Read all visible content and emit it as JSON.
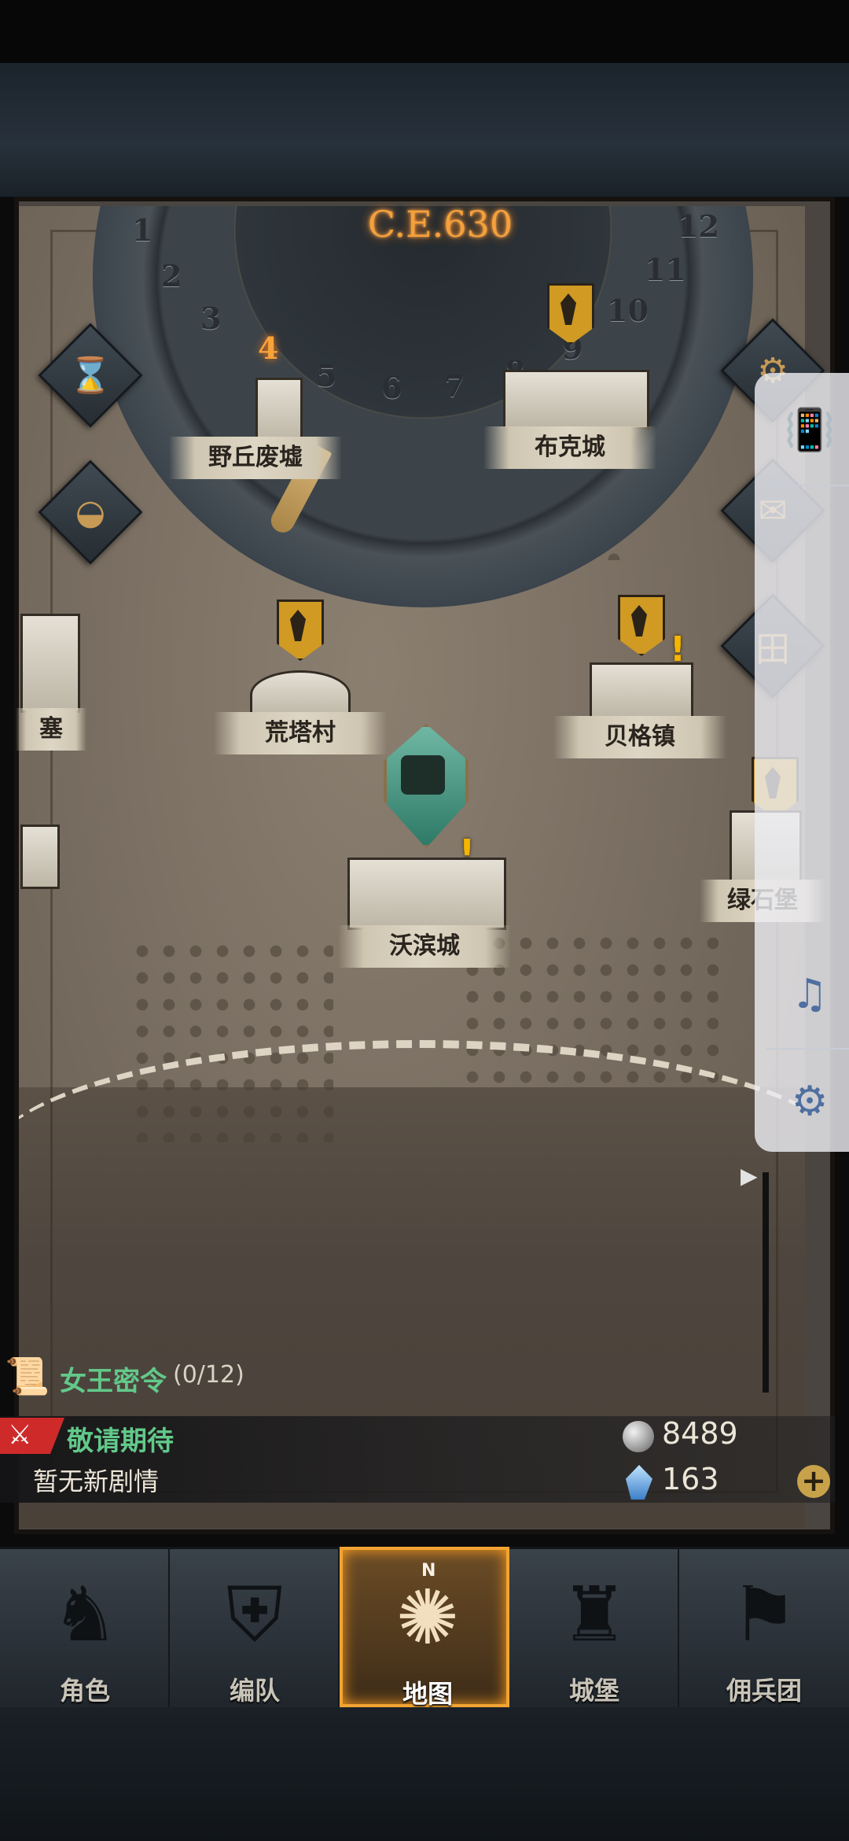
{
  "map": {
    "year_label": "C.E.630",
    "dial_numbers": [
      "1",
      "2",
      "3",
      "4",
      "5",
      "6",
      "7",
      "8",
      "9",
      "10",
      "11",
      "12"
    ],
    "active_month": "4",
    "towns": [
      {
        "name": "野丘废墟"
      },
      {
        "name": "布克城"
      },
      {
        "name": "荒塔村"
      },
      {
        "name": "贝格镇"
      },
      {
        "name": "沃滨城"
      },
      {
        "name": "绿石堡"
      },
      {
        "name": "塞"
      }
    ]
  },
  "left_buttons": [
    {
      "icon": "hourglass-icon",
      "glyph": "⌛"
    },
    {
      "icon": "bag-icon",
      "glyph": "◒"
    }
  ],
  "right_buttons": [
    {
      "icon": "settings-gear-icon",
      "glyph": "⚙"
    },
    {
      "icon": "mail-icon",
      "glyph": "✉"
    },
    {
      "icon": "menu-grid-icon",
      "glyph": "田"
    }
  ],
  "floating_toolbar": [
    {
      "icon": "vibrate-icon",
      "glyph": "📳"
    },
    {
      "icon": "music-note-icon",
      "glyph": "♫"
    },
    {
      "icon": "gear-icon",
      "glyph": "⚙"
    }
  ],
  "quest": {
    "title": "女王密令",
    "progress": "(0/12)",
    "progress_fraction": 0
  },
  "story": {
    "badge_glyph": "⚔",
    "status": "敬请期待",
    "note": "暂无新剧情"
  },
  "resources": {
    "silver": "8489",
    "crystals": "163",
    "add_glyph": "+"
  },
  "nav": {
    "items": [
      {
        "label": "角色",
        "glyph": "♞"
      },
      {
        "label": "编队",
        "glyph": "⛨"
      },
      {
        "label": "地图",
        "glyph": "✺"
      },
      {
        "label": "城堡",
        "glyph": "♜"
      },
      {
        "label": "佣兵团",
        "glyph": "⚑"
      }
    ],
    "active_index": 2,
    "compass_letter": "N"
  },
  "colors": {
    "accent_orange": "#f2a431",
    "quest_green": "#62c98a",
    "badge_red": "#cf2a2a",
    "banner_gold": "#d09a23"
  }
}
